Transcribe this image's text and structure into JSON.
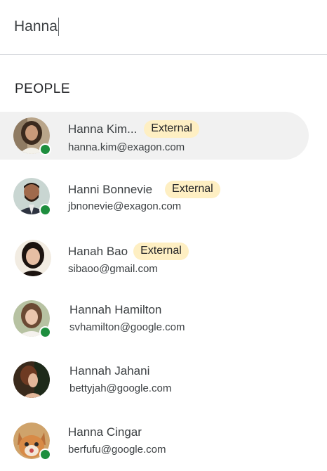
{
  "search": {
    "value": "Hanna"
  },
  "section_title": "PEOPLE",
  "people": [
    {
      "name": "Hanna Kim...",
      "badge": "External",
      "email": "hanna.kim@exagon.com",
      "online": true,
      "selected": true
    },
    {
      "name": "Hanni Bonnevie",
      "badge": "External",
      "email": "jbnonevie@exagon.com",
      "online": true
    },
    {
      "name": "Hanah Bao",
      "badge": "External",
      "email": "sibaoo@gmail.com",
      "online": false
    },
    {
      "name": "Hannah Hamilton",
      "badge": "",
      "email": "svhamilton@google.com",
      "online": true
    },
    {
      "name": "Hannah Jahani",
      "badge": "",
      "email": "bettyjah@google.com",
      "online": false
    },
    {
      "name": "Hanna Cingar",
      "badge": "",
      "email": "berfufu@google.com",
      "online": true
    }
  ],
  "colors": {
    "presence": "#1e8e3e",
    "badge_bg": "#feefc3",
    "selected_bg": "#f1f1f1"
  }
}
